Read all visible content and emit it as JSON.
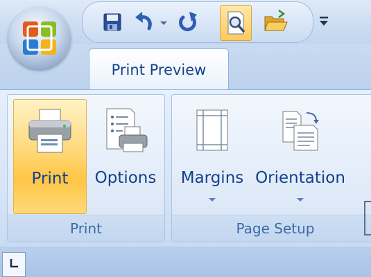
{
  "ribbon": {
    "active_tab": "Print Preview",
    "groups": {
      "print": {
        "label": "Print",
        "buttons": {
          "print": "Print",
          "options": "Options"
        }
      },
      "page_setup": {
        "label": "Page Setup",
        "buttons": {
          "margins": "Margins",
          "orientation": "Orientation"
        }
      }
    }
  },
  "quick_access_toolbar": {
    "icons": [
      "save-icon",
      "undo-icon",
      "undo-dropdown-icon",
      "redo-icon",
      "print-preview-icon",
      "open-folder-icon",
      "customize-qat-icon"
    ],
    "active": "print-preview-icon"
  },
  "colors": {
    "accent_text": "#15428b",
    "group_label_text": "#3e6aa8",
    "active_button": "#ffc545"
  }
}
